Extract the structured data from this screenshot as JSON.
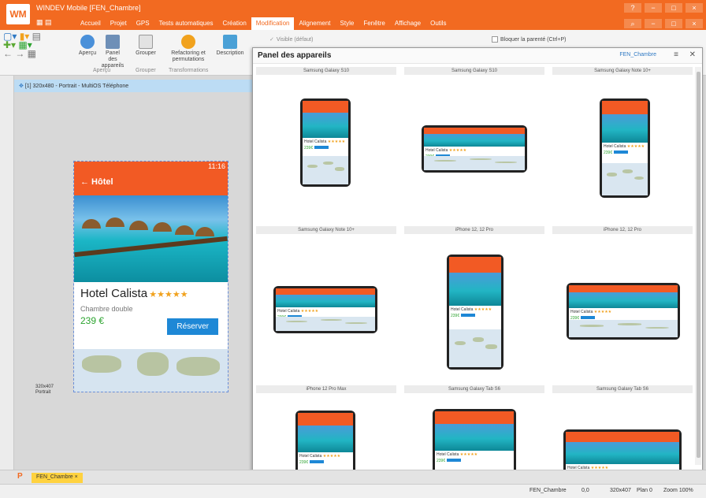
{
  "app": {
    "logo": "WM",
    "title": "WINDEV Mobile [FEN_Chambre]"
  },
  "menu": [
    "Accueil",
    "Projet",
    "GPS",
    "Tests automatiques",
    "Création",
    "Modification",
    "Alignement",
    "Style",
    "Fenêtre",
    "Affichage",
    "Outils"
  ],
  "menu_active": "Modification",
  "ribbon": {
    "apercu": "Aperçu",
    "panel_appareils": "Panel des appareils",
    "grouper": "Grouper",
    "refactoring": "Refactoring et permutations",
    "description": "Description",
    "group_apercu": "Aperçu",
    "group_grouper": "Grouper",
    "group_transformations": "Transformations",
    "visible_label": "Visible (défaut)",
    "bloquer": "Bloquer la parenté (Ctrl+P)"
  },
  "editor": {
    "tab_label": "[1] 320x480 - Portrait - MultiOS Téléphone",
    "size_label": "320x407",
    "orientation": "Portrait"
  },
  "phone": {
    "time": "11:16",
    "back_title": "← Hôtel",
    "hotel_name": "Hotel Calista",
    "stars": "★★★★★",
    "room": "Chambre double",
    "price": "239 €",
    "book_button": "Réserver"
  },
  "panel": {
    "title": "Panel des appareils",
    "window_name": "FEN_Chambre",
    "devices": [
      "Samsung Galaxy S10",
      "Samsung Galaxy S10",
      "Samsung Galaxy Note 10+",
      "Samsung Galaxy Note 10+",
      "iPhone 12, 12 Pro",
      "iPhone 12, 12 Pro",
      "iPhone 12 Pro Max",
      "Samsung Galaxy Tab S6",
      "Samsung Galaxy Tab S6"
    ],
    "mini_name": "Hotel Calista",
    "mini_price": "239€"
  },
  "bottom": {
    "doc_tab": "FEN_Chambre"
  },
  "status": {
    "window": "FEN_Chambre",
    "coords": "0,0",
    "size": "320x407",
    "plan": "Plan 0",
    "zoom": "Zoom 100%"
  }
}
